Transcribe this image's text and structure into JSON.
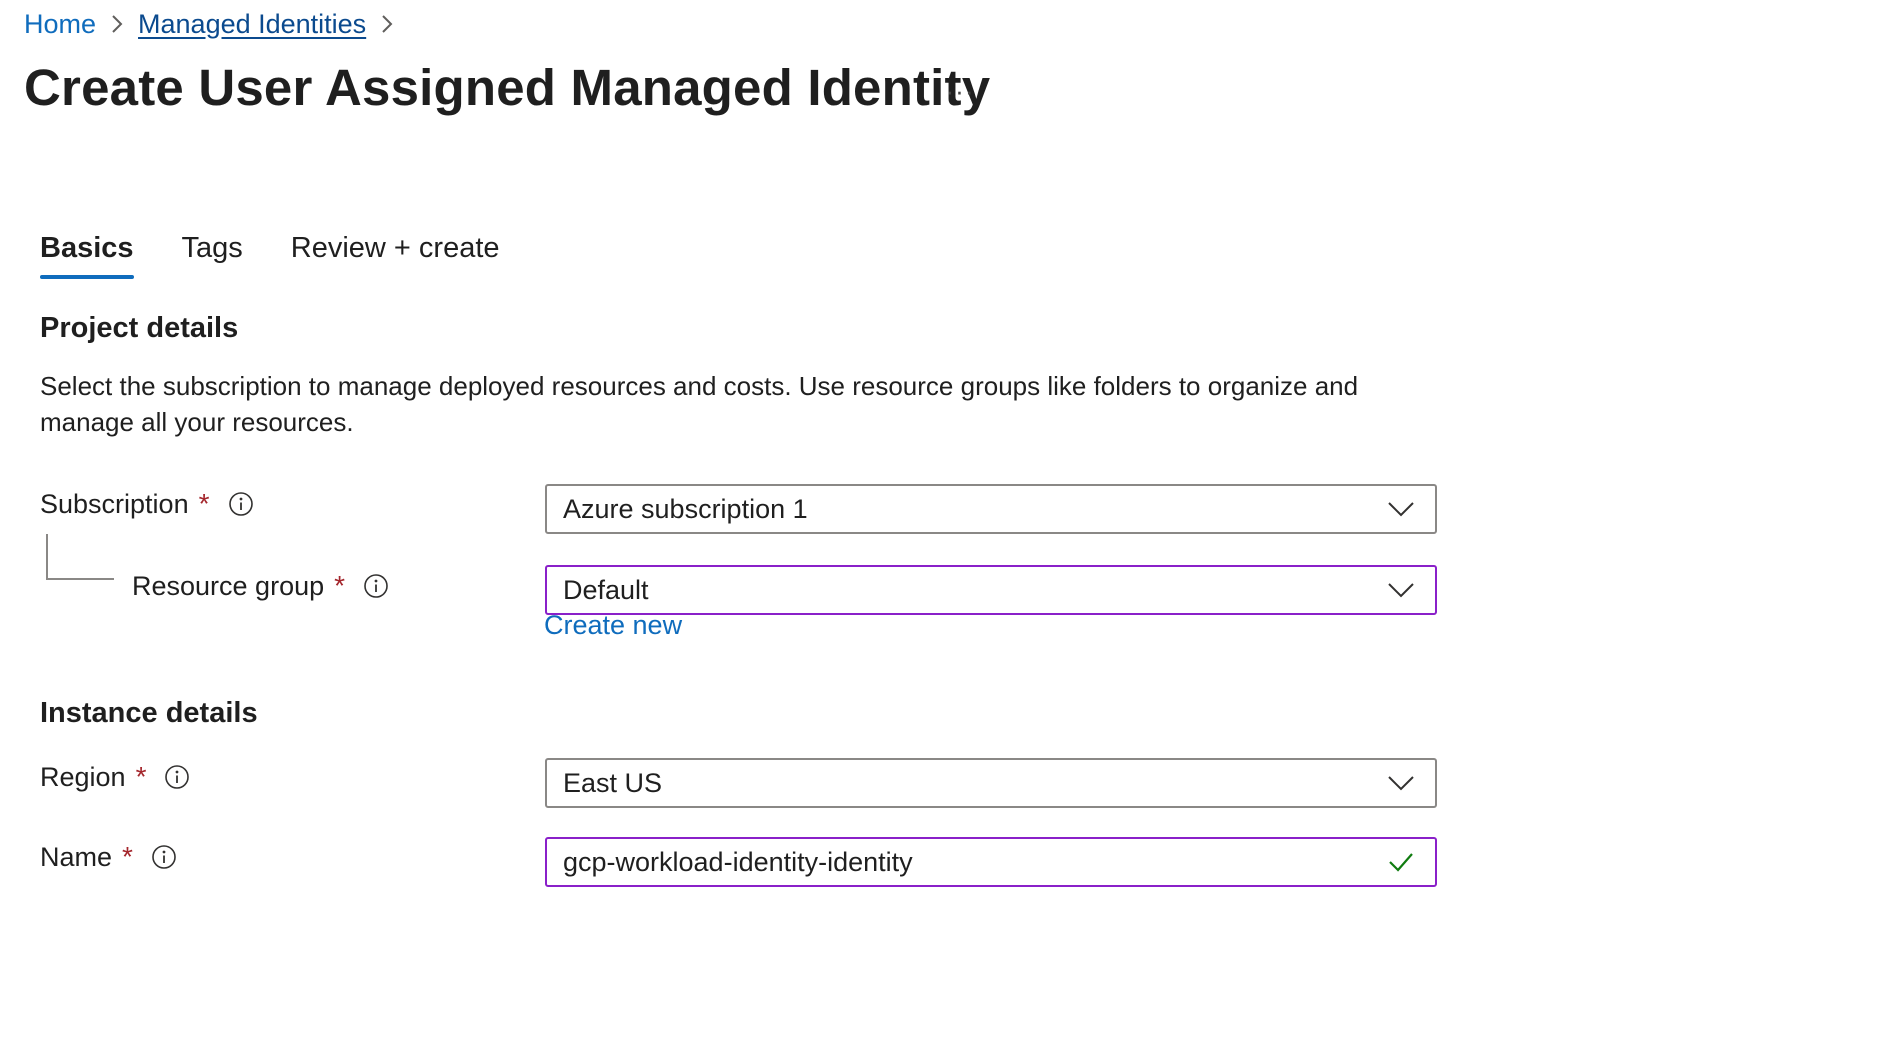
{
  "breadcrumb": {
    "home": "Home",
    "managed_identities": "Managed Identities"
  },
  "page": {
    "title": "Create User Assigned Managed Identity",
    "more_label": "···"
  },
  "tabs": [
    {
      "label": "Basics",
      "active": true
    },
    {
      "label": "Tags",
      "active": false
    },
    {
      "label": "Review + create",
      "active": false
    }
  ],
  "project_details": {
    "heading": "Project details",
    "description": "Select the subscription to manage deployed resources and costs. Use resource groups like folders to organize and manage all your resources."
  },
  "fields": {
    "subscription": {
      "label": "Subscription",
      "required": "*",
      "value": "Azure subscription 1"
    },
    "resource_group": {
      "label": "Resource group",
      "required": "*",
      "value": "Default",
      "create_new": "Create new"
    },
    "region": {
      "label": "Region",
      "required": "*",
      "value": "East US"
    },
    "name": {
      "label": "Name",
      "required": "*",
      "value": "gcp-workload-identity-identity"
    }
  },
  "instance_details": {
    "heading": "Instance details"
  },
  "colors": {
    "link": "#0f6cbd",
    "required": "#a4262c",
    "focus_border": "#8a20c9",
    "valid_check": "#107c10",
    "tab_underline": "#0f6cbd"
  }
}
